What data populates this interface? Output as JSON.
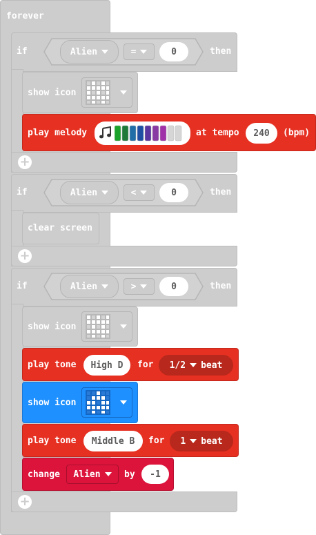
{
  "forever": {
    "label": "forever"
  },
  "if1": {
    "if_label": "if",
    "variable": "Alien",
    "operator": "=",
    "value": "0",
    "then_label": "then",
    "show_icon_label": "show icon",
    "melody": {
      "label": "play melody",
      "tempo_label": "at tempo",
      "tempo": "240",
      "unit": "(bpm)",
      "note_colors": [
        "#1aa22b",
        "#1f7a3a",
        "#1f6ea8",
        "#1e4fa3",
        "#5b36a0",
        "#8a3aa3",
        "#a031a8",
        "#d6d6d6",
        "#d6d6d6"
      ]
    }
  },
  "if2": {
    "if_label": "if",
    "variable": "Alien",
    "operator": "<",
    "value": "0",
    "then_label": "then",
    "clear_label": "clear screen"
  },
  "if3": {
    "if_label": "if",
    "variable": "Alien",
    "operator": ">",
    "value": "0",
    "then_label": "then",
    "show_icon_label": "show icon",
    "tone1": {
      "label": "play tone",
      "note": "High D",
      "for_label": "for",
      "beat": "1/2",
      "beat_label": "beat"
    },
    "show_icon2_label": "show icon",
    "tone2": {
      "label": "play tone",
      "note": "Middle B",
      "for_label": "for",
      "beat": "1",
      "beat_label": "beat"
    },
    "change": {
      "label": "change",
      "variable": "Alien",
      "by_label": "by",
      "amount": "-1"
    }
  },
  "colors": {
    "disabled": "#cdcdcd",
    "music": "#e63022",
    "music_dark": "#b8281c",
    "basic": "#1e90ff",
    "variables": "#dc143c"
  },
  "icons": {
    "add": "plus-icon",
    "note": "music-note-icon",
    "dropdown": "dropdown-arrow-icon"
  }
}
